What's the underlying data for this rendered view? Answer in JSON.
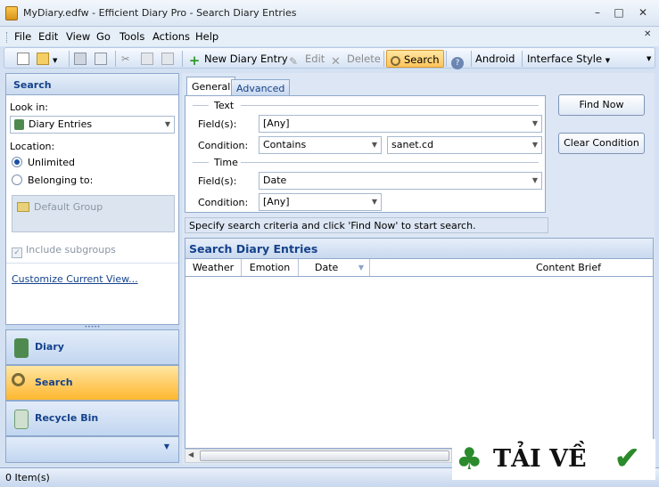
{
  "window": {
    "title": "MyDiary.edfw - Efficient Diary Pro - Search Diary Entries"
  },
  "menu": [
    "File",
    "Edit",
    "View",
    "Go",
    "Tools",
    "Actions",
    "Help"
  ],
  "toolbar": {
    "new_entry": "New Diary Entry",
    "edit": "Edit",
    "delete": "Delete",
    "search": "Search",
    "android": "Android",
    "interface_style": "Interface Style"
  },
  "left_panel": {
    "header": "Search",
    "look_in_label": "Look in:",
    "look_in_value": "Diary Entries",
    "location_label": "Location:",
    "unlimited": "Unlimited",
    "belonging_to": "Belonging to:",
    "default_group": "Default Group",
    "include_subgroups": "Include subgroups",
    "customize_view": "Customize Current View..."
  },
  "nav": {
    "diary": "Diary",
    "search": "Search",
    "recycle_bin": "Recycle Bin"
  },
  "tabs": {
    "general": "General",
    "advanced": "Advanced"
  },
  "criteria": {
    "text_section": "Text",
    "time_section": "Time",
    "field_label": "Field(s):",
    "condition_label": "Condition:",
    "text_field_value": "[Any]",
    "text_condition_value": "Contains",
    "text_query": "sanet.cd",
    "time_field_value": "Date",
    "time_condition_value": "[Any]"
  },
  "buttons": {
    "find_now": "Find Now",
    "clear_condition": "Clear Condition"
  },
  "hint": "Specify search criteria and click 'Find Now' to start search.",
  "results": {
    "title": "Search Diary Entries",
    "columns": [
      "Weather",
      "Emotion",
      "Date",
      "Content Brief"
    ]
  },
  "status": "0 Item(s)",
  "watermark": "TẢI VỀ",
  "colors": {
    "accent": "#15428b",
    "active": "#ffc45a",
    "frame": "#8fa9cc"
  }
}
